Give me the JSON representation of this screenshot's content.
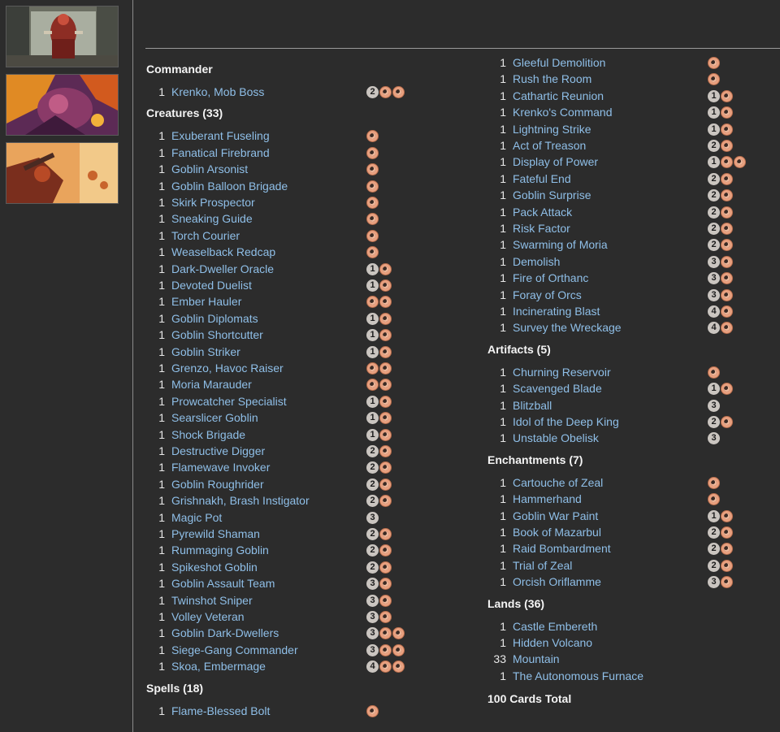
{
  "images": [
    {
      "name": "krenko-art-thumbnail"
    },
    {
      "name": "demon-art-thumbnail"
    },
    {
      "name": "goblin-assault-art-thumbnail"
    }
  ],
  "colors": {
    "background": "#2c2c2c",
    "link": "#8fbfe8",
    "red_mana": "#e8a07f",
    "generic_mana": "#cac5c0"
  },
  "left_sections": [
    {
      "title": "Commander",
      "cards": [
        {
          "qty": "1",
          "name": "Krenko, Mob Boss",
          "cost": [
            "2",
            "R",
            "R"
          ]
        }
      ]
    },
    {
      "title": "Creatures (33)",
      "cards": [
        {
          "qty": "1",
          "name": "Exuberant Fuseling",
          "cost": [
            "R"
          ]
        },
        {
          "qty": "1",
          "name": "Fanatical Firebrand",
          "cost": [
            "R"
          ]
        },
        {
          "qty": "1",
          "name": "Goblin Arsonist",
          "cost": [
            "R"
          ]
        },
        {
          "qty": "1",
          "name": "Goblin Balloon Brigade",
          "cost": [
            "R"
          ]
        },
        {
          "qty": "1",
          "name": "Skirk Prospector",
          "cost": [
            "R"
          ]
        },
        {
          "qty": "1",
          "name": "Sneaking Guide",
          "cost": [
            "R"
          ]
        },
        {
          "qty": "1",
          "name": "Torch Courier",
          "cost": [
            "R"
          ]
        },
        {
          "qty": "1",
          "name": "Weaselback Redcap",
          "cost": [
            "R"
          ]
        },
        {
          "qty": "1",
          "name": "Dark-Dweller Oracle",
          "cost": [
            "1",
            "R"
          ]
        },
        {
          "qty": "1",
          "name": "Devoted Duelist",
          "cost": [
            "1",
            "R"
          ]
        },
        {
          "qty": "1",
          "name": "Ember Hauler",
          "cost": [
            "R",
            "R"
          ]
        },
        {
          "qty": "1",
          "name": "Goblin Diplomats",
          "cost": [
            "1",
            "R"
          ]
        },
        {
          "qty": "1",
          "name": "Goblin Shortcutter",
          "cost": [
            "1",
            "R"
          ]
        },
        {
          "qty": "1",
          "name": "Goblin Striker",
          "cost": [
            "1",
            "R"
          ]
        },
        {
          "qty": "1",
          "name": "Grenzo, Havoc Raiser",
          "cost": [
            "R",
            "R"
          ]
        },
        {
          "qty": "1",
          "name": "Moria Marauder",
          "cost": [
            "R",
            "R"
          ]
        },
        {
          "qty": "1",
          "name": "Prowcatcher Specialist",
          "cost": [
            "1",
            "R"
          ]
        },
        {
          "qty": "1",
          "name": "Searslicer Goblin",
          "cost": [
            "1",
            "R"
          ]
        },
        {
          "qty": "1",
          "name": "Shock Brigade",
          "cost": [
            "1",
            "R"
          ]
        },
        {
          "qty": "1",
          "name": "Destructive Digger",
          "cost": [
            "2",
            "R"
          ]
        },
        {
          "qty": "1",
          "name": "Flamewave Invoker",
          "cost": [
            "2",
            "R"
          ]
        },
        {
          "qty": "1",
          "name": "Goblin Roughrider",
          "cost": [
            "2",
            "R"
          ]
        },
        {
          "qty": "1",
          "name": "Grishnakh, Brash Instigator",
          "cost": [
            "2",
            "R"
          ]
        },
        {
          "qty": "1",
          "name": "Magic Pot",
          "cost": [
            "3"
          ]
        },
        {
          "qty": "1",
          "name": "Pyrewild Shaman",
          "cost": [
            "2",
            "R"
          ]
        },
        {
          "qty": "1",
          "name": "Rummaging Goblin",
          "cost": [
            "2",
            "R"
          ]
        },
        {
          "qty": "1",
          "name": "Spikeshot Goblin",
          "cost": [
            "2",
            "R"
          ]
        },
        {
          "qty": "1",
          "name": "Goblin Assault Team",
          "cost": [
            "3",
            "R"
          ]
        },
        {
          "qty": "1",
          "name": "Twinshot Sniper",
          "cost": [
            "3",
            "R"
          ]
        },
        {
          "qty": "1",
          "name": "Volley Veteran",
          "cost": [
            "3",
            "R"
          ]
        },
        {
          "qty": "1",
          "name": "Goblin Dark-Dwellers",
          "cost": [
            "3",
            "R",
            "R"
          ]
        },
        {
          "qty": "1",
          "name": "Siege-Gang Commander",
          "cost": [
            "3",
            "R",
            "R"
          ]
        },
        {
          "qty": "1",
          "name": "Skoa, Embermage",
          "cost": [
            "4",
            "R",
            "R"
          ]
        }
      ]
    },
    {
      "title": "Spells (18)",
      "cards": [
        {
          "qty": "1",
          "name": "Flame-Blessed Bolt",
          "cost": [
            "R"
          ]
        }
      ]
    }
  ],
  "right_sections": [
    {
      "title": "",
      "cards": [
        {
          "qty": "1",
          "name": "Gleeful Demolition",
          "cost": [
            "R"
          ]
        },
        {
          "qty": "1",
          "name": "Rush the Room",
          "cost": [
            "R"
          ]
        },
        {
          "qty": "1",
          "name": "Cathartic Reunion",
          "cost": [
            "1",
            "R"
          ]
        },
        {
          "qty": "1",
          "name": "Krenko's Command",
          "cost": [
            "1",
            "R"
          ]
        },
        {
          "qty": "1",
          "name": "Lightning Strike",
          "cost": [
            "1",
            "R"
          ]
        },
        {
          "qty": "1",
          "name": "Act of Treason",
          "cost": [
            "2",
            "R"
          ]
        },
        {
          "qty": "1",
          "name": "Display of Power",
          "cost": [
            "1",
            "R",
            "R"
          ]
        },
        {
          "qty": "1",
          "name": "Fateful End",
          "cost": [
            "2",
            "R"
          ]
        },
        {
          "qty": "1",
          "name": "Goblin Surprise",
          "cost": [
            "2",
            "R"
          ]
        },
        {
          "qty": "1",
          "name": "Pack Attack",
          "cost": [
            "2",
            "R"
          ]
        },
        {
          "qty": "1",
          "name": "Risk Factor",
          "cost": [
            "2",
            "R"
          ]
        },
        {
          "qty": "1",
          "name": "Swarming of Moria",
          "cost": [
            "2",
            "R"
          ]
        },
        {
          "qty": "1",
          "name": "Demolish",
          "cost": [
            "3",
            "R"
          ]
        },
        {
          "qty": "1",
          "name": "Fire of Orthanc",
          "cost": [
            "3",
            "R"
          ]
        },
        {
          "qty": "1",
          "name": "Foray of Orcs",
          "cost": [
            "3",
            "R"
          ]
        },
        {
          "qty": "1",
          "name": "Incinerating Blast",
          "cost": [
            "4",
            "R"
          ]
        },
        {
          "qty": "1",
          "name": "Survey the Wreckage",
          "cost": [
            "4",
            "R"
          ]
        }
      ]
    },
    {
      "title": "Artifacts (5)",
      "cards": [
        {
          "qty": "1",
          "name": "Churning Reservoir",
          "cost": [
            "R"
          ]
        },
        {
          "qty": "1",
          "name": "Scavenged Blade",
          "cost": [
            "1",
            "R"
          ]
        },
        {
          "qty": "1",
          "name": "Blitzball",
          "cost": [
            "3"
          ]
        },
        {
          "qty": "1",
          "name": "Idol of the Deep King",
          "cost": [
            "2",
            "R"
          ]
        },
        {
          "qty": "1",
          "name": "Unstable Obelisk",
          "cost": [
            "3"
          ]
        }
      ]
    },
    {
      "title": "Enchantments (7)",
      "cards": [
        {
          "qty": "1",
          "name": "Cartouche of Zeal",
          "cost": [
            "R"
          ]
        },
        {
          "qty": "1",
          "name": "Hammerhand",
          "cost": [
            "R"
          ]
        },
        {
          "qty": "1",
          "name": "Goblin War Paint",
          "cost": [
            "1",
            "R"
          ]
        },
        {
          "qty": "1",
          "name": "Book of Mazarbul",
          "cost": [
            "2",
            "R"
          ]
        },
        {
          "qty": "1",
          "name": "Raid Bombardment",
          "cost": [
            "2",
            "R"
          ]
        },
        {
          "qty": "1",
          "name": "Trial of Zeal",
          "cost": [
            "2",
            "R"
          ]
        },
        {
          "qty": "1",
          "name": "Orcish Oriflamme",
          "cost": [
            "3",
            "R"
          ]
        }
      ]
    },
    {
      "title": "Lands (36)",
      "cards": [
        {
          "qty": "1",
          "name": "Castle Embereth",
          "cost": []
        },
        {
          "qty": "1",
          "name": "Hidden Volcano",
          "cost": []
        },
        {
          "qty": "33",
          "name": "Mountain",
          "cost": []
        },
        {
          "qty": "1",
          "name": "The Autonomous Furnace",
          "cost": []
        }
      ]
    }
  ],
  "total_label": "100 Cards Total"
}
